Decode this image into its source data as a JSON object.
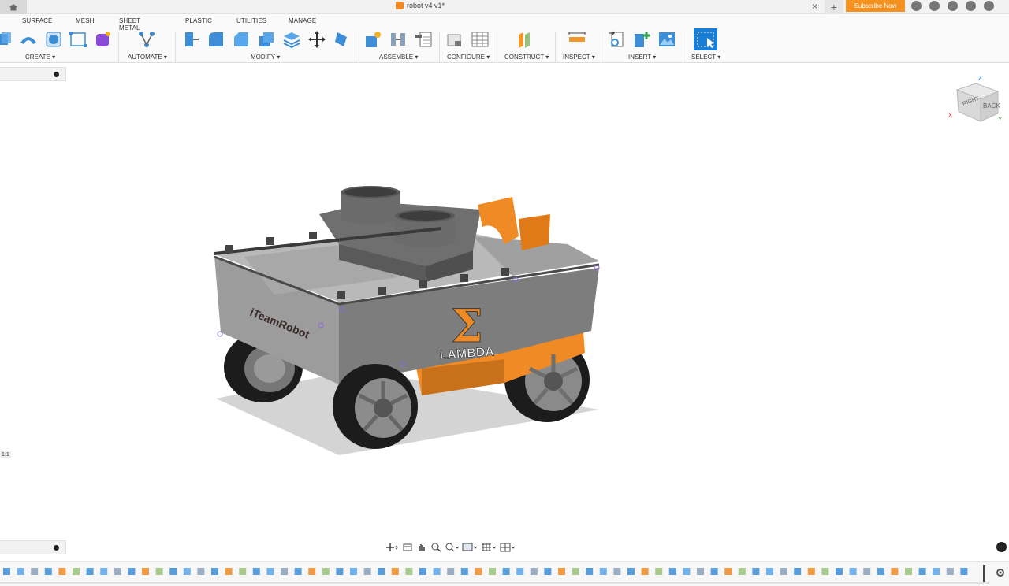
{
  "titlebar": {
    "document_title": "robot v4 v1*",
    "close_label": "×",
    "new_tab_label": "+",
    "subscribe_label": "Subscribe Now",
    "accent_color": "#f5911e"
  },
  "ribbon": {
    "tabs": [
      "SURFACE",
      "MESH",
      "SHEET METAL",
      "PLASTIC",
      "UTILITIES",
      "MANAGE"
    ],
    "groups": [
      "CREATE ▾",
      "AUTOMATE ▾",
      "MODIFY ▾",
      "ASSEMBLE ▾",
      "CONFIGURE ▾",
      "CONSTRUCT ▾",
      "INSPECT ▾",
      "INSERT ▾",
      "SELECT ▾"
    ]
  },
  "panels": {
    "scale_label": "1:1"
  },
  "model": {
    "brand_text": "iTeamRobot",
    "logo_letter": "Σ",
    "logo_text": "LAMBDA",
    "accent_orange": "#f08a24"
  },
  "viewcube": {
    "face_back": "BACK",
    "face_right": "RIGHT",
    "axis_x": "X",
    "axis_y": "Y",
    "axis_z": "Z"
  },
  "navbar": {
    "icons": [
      "orbit-icon",
      "look-at-icon",
      "pan-icon",
      "zoom-icon",
      "fit-icon",
      "display-settings-icon",
      "grid-settings-icon",
      "viewports-icon"
    ]
  },
  "timeline": {
    "item_count": 70
  }
}
